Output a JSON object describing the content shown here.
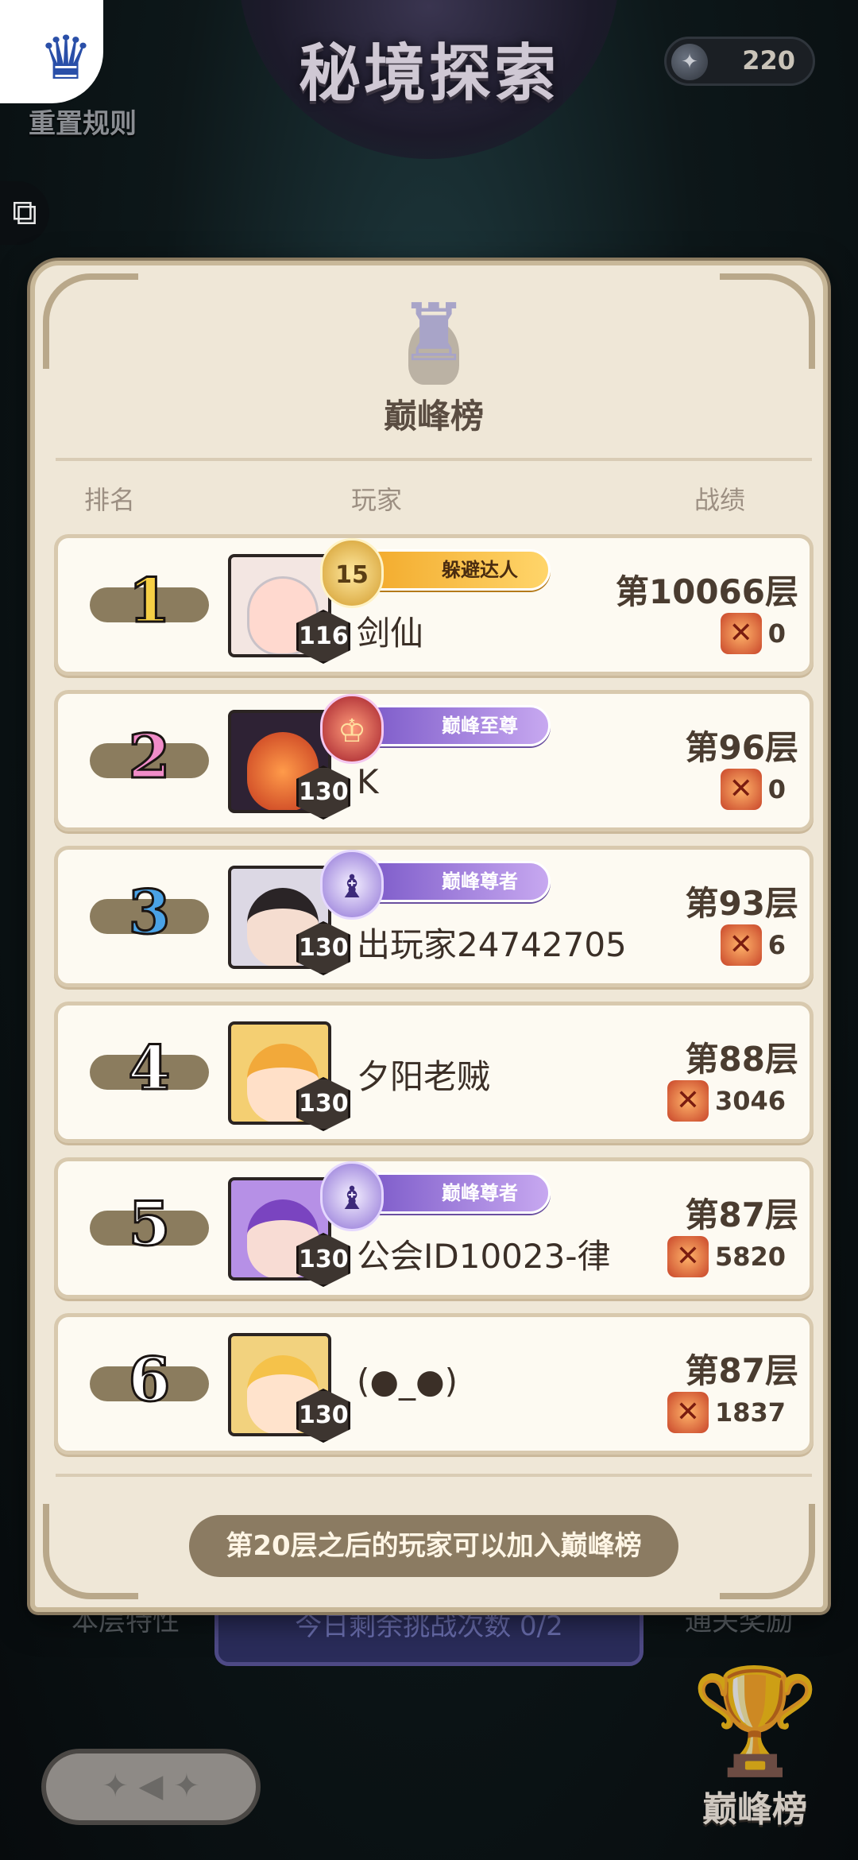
{
  "header": {
    "title": "秘境探索",
    "reset_label": "重置规则",
    "currency_value": "220"
  },
  "background": {
    "left_hint": "本层特性",
    "right_hint": "通关奖励",
    "challenge_text": "今日剩余挑战次数 0/2",
    "peak_button_label": "巅峰榜"
  },
  "leaderboard": {
    "title": "巅峰榜",
    "columns": {
      "rank": "排名",
      "player": "玩家",
      "record": "战绩"
    },
    "rows": [
      {
        "rank": "1",
        "level": "116",
        "name": "剑仙",
        "floor": "第10066层",
        "stat": "0",
        "title": "躲避达人",
        "emblem": "15"
      },
      {
        "rank": "2",
        "level": "130",
        "name": "K",
        "floor": "第96层",
        "stat": "0",
        "title": "巅峰至尊",
        "emblem": ""
      },
      {
        "rank": "3",
        "level": "130",
        "name": "出玩家24742705",
        "floor": "第93层",
        "stat": "6",
        "title": "巅峰尊者",
        "emblem": ""
      },
      {
        "rank": "4",
        "level": "130",
        "name": "夕阳老贼",
        "floor": "第88层",
        "stat": "3046",
        "title": "",
        "emblem": ""
      },
      {
        "rank": "5",
        "level": "130",
        "name": "公会ID10023-律",
        "floor": "第87层",
        "stat": "5820",
        "title": "巅峰尊者",
        "emblem": ""
      },
      {
        "rank": "6",
        "level": "130",
        "name": "(●_●)",
        "floor": "第87层",
        "stat": "1837",
        "title": "",
        "emblem": ""
      }
    ],
    "footer_note": "第20层之后的玩家可以加入巅峰榜"
  },
  "colors": {
    "panel": "#efe7d7",
    "rank1": "#f6cf45",
    "rank2": "#f08cc8",
    "rank3": "#4aa2e6",
    "badge_purple": "#9b7ae0",
    "badge_gold": "#f2a92a"
  },
  "icons": [
    "trophy-icon",
    "coin-icon",
    "puzzle-icon",
    "swords-icon",
    "back-arrow-icon"
  ]
}
